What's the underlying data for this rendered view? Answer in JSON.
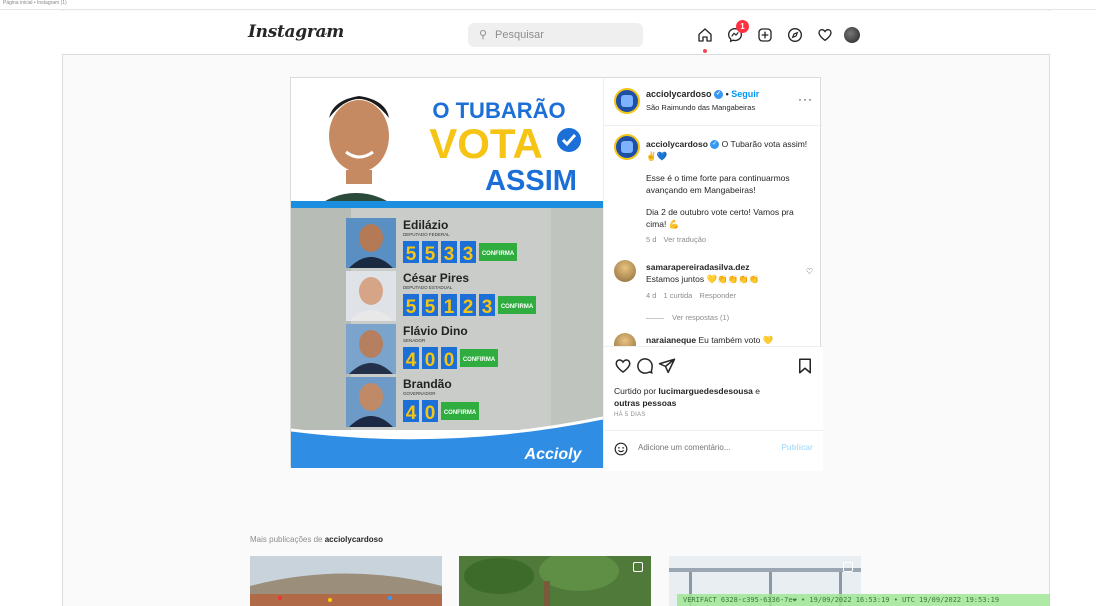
{
  "browser": {
    "top_strip_text": "Página inicial • Instagram (1)"
  },
  "nav": {
    "logo": "Instagram",
    "search_placeholder": "Pesquisar",
    "messages_badge": "1"
  },
  "post": {
    "author": "acciolycardoso",
    "follow_label": "Seguir",
    "location": "São Raimundo das Mangabeiras",
    "caption_author": "acciolycardoso",
    "caption_line1": "O Tubarão vota assim! ✌️💙",
    "caption_line2": "Esse é o time forte para continuarmos avançando em Mangabeiras!",
    "caption_line3": "Dia 2 de outubro vote certo! Vamos pra cima! 💪",
    "caption_age": "5 d",
    "caption_translate": "Ver tradução",
    "comments": [
      {
        "user": "samarapereiradasilva.dez",
        "text": "Estamos juntos 💛👏👏👏👏",
        "age": "4 d",
        "likes": "1 curtida",
        "reply": "Responder",
        "view_replies": "Ver respostas (1)"
      },
      {
        "user": "naraianeque",
        "text": "Eu também voto 💛"
      }
    ],
    "liked_by_prefix": "Curtido por ",
    "liked_by_user": "lucimarguedesdesousa",
    "liked_by_suffix": " e",
    "liked_by_others": "outras pessoas",
    "time_ago": "HÁ 5 DIAS",
    "comment_placeholder": "Adicione um comentário...",
    "publish_label": "Publicar"
  },
  "poster": {
    "headline_1": "O TUBARÃO",
    "headline_2": "VOTA",
    "headline_3": "ASSIM",
    "candidates": [
      {
        "name": "Edilázio",
        "role": "DEPUTADO FEDERAL",
        "digits": [
          "5",
          "5",
          "3",
          "3"
        ],
        "confirm": "CONFIRMA"
      },
      {
        "name": "César Pires",
        "role": "DEPUTADO ESTADUAL",
        "digits": [
          "5",
          "5",
          "1",
          "2",
          "3"
        ],
        "confirm": "CONFIRMA"
      },
      {
        "name": "Flávio Dino",
        "role": "SENADOR",
        "digits": [
          "4",
          "0",
          "0"
        ],
        "confirm": "CONFIRMA"
      },
      {
        "name": "Brandão",
        "role": "GOVERNADOR",
        "digits": [
          "4",
          "0"
        ],
        "confirm": "CONFIRMA"
      }
    ],
    "brand": "Accioly"
  },
  "more_posts": {
    "prefix": "Mais publicações de ",
    "user": "acciolycardoso"
  },
  "watermark": "VERIFACT 6328-c395-6336-7e❤ • 19/09/2022 16:53:19 • UTC 19/09/2022 19:53:19",
  "colors": {
    "accent_blue": "#0095f6",
    "poster_blue": "#1b6fd6",
    "poster_yellow": "#f6c415",
    "confirm_green": "#2fae3f",
    "badge_red": "#ff3040"
  }
}
